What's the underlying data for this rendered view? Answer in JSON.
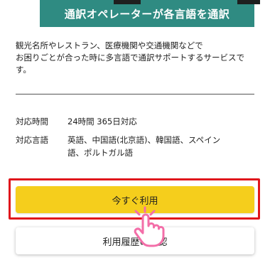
{
  "banner": {
    "title": "通訳オペレーターが各言語を通訳"
  },
  "description": {
    "line1": "観光名所やレストラン、医療機関や交通機関などで",
    "line2": "お困りごとが合った時に多言語で通訳サポートするサービスで",
    "line3": "す。"
  },
  "info": {
    "hours_label": "対応時間",
    "hours_value": "24時間 365日対応",
    "languages_label": "対応言語",
    "languages_value_line1": "英語、中国語(北京語)、韓国語、スペイン",
    "languages_value_line2": "語、ポルトガル語"
  },
  "buttons": {
    "use_now_label": "今すぐ利用",
    "history_label": "利用履歴の確認"
  },
  "colors": {
    "banner": "#2f8b82",
    "primary_button": "#f5ce1c",
    "highlight": "#e0161c",
    "hand_pointer": "#f36ea8"
  },
  "icons": {
    "pointer": "hand-pointer-icon"
  }
}
